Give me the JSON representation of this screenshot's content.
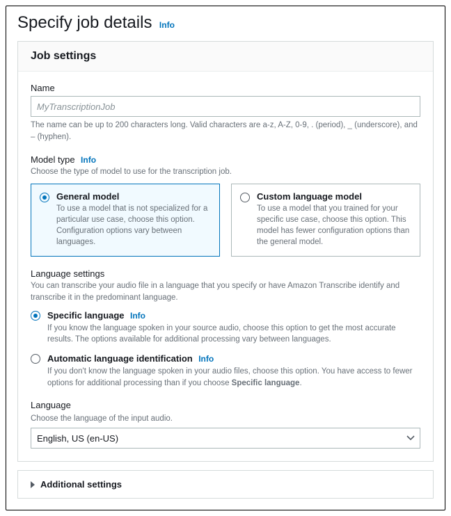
{
  "page": {
    "title": "Specify job details",
    "info": "Info"
  },
  "jobSettings": {
    "panelTitle": "Job settings",
    "name": {
      "label": "Name",
      "placeholder": "MyTranscriptionJob",
      "helper": "The name can be up to 200 characters long. Valid characters are a-z, A-Z, 0-9, . (period), _ (underscore), and – (hyphen)."
    },
    "modelType": {
      "label": "Model type",
      "info": "Info",
      "helper": "Choose the type of model to use for the transcription job.",
      "options": {
        "general": {
          "title": "General model",
          "desc": "To use a model that is not specialized for a particular use case, choose this option. Configuration options vary between languages."
        },
        "custom": {
          "title": "Custom language model",
          "desc": "To use a model that you trained for your specific use case, choose this option. This model has fewer configuration options than the general model."
        }
      }
    },
    "languageSettings": {
      "label": "Language settings",
      "helper": "You can transcribe your audio file in a language that you specify or have Amazon Transcribe identify and transcribe it in the predominant language.",
      "options": {
        "specific": {
          "title": "Specific language",
          "info": "Info",
          "desc": "If you know the language spoken in your source audio, choose this option to get the most accurate results. The options available for additional processing vary between languages."
        },
        "auto": {
          "title": "Automatic language identification",
          "info": "Info",
          "descPrefix": "If you don't know the language spoken in your audio files, choose this option. You have access to fewer options for additional processing than if you choose ",
          "descBold": "Specific language",
          "descSuffix": "."
        }
      }
    },
    "language": {
      "label": "Language",
      "helper": "Choose the language of the input audio.",
      "value": "English, US (en-US)"
    }
  },
  "additional": {
    "title": "Additional settings"
  }
}
